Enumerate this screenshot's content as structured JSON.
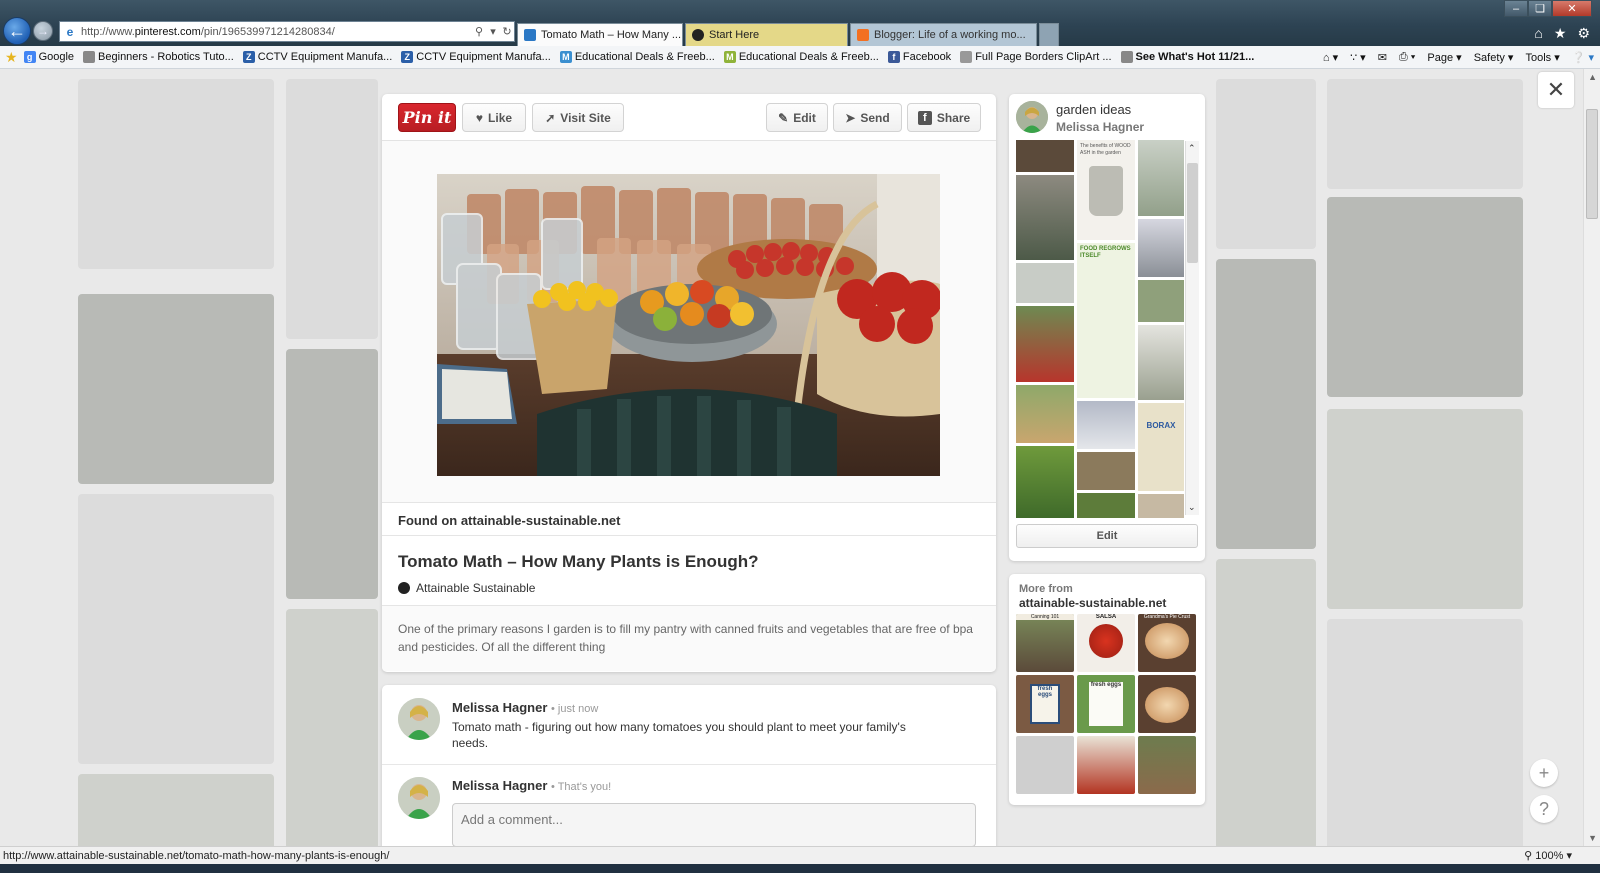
{
  "browser": {
    "address": {
      "prefix": "http://www.",
      "domain": "pinterest.com",
      "path": "/pin/196539971214280834/"
    },
    "tabs": [
      {
        "label": "Tomato Math – How Many ...",
        "active": true,
        "icon_color": "#2b78c5"
      },
      {
        "label": "Start Here",
        "active": false,
        "icon_color": "#222222"
      },
      {
        "label": "Blogger: Life of a working mo...",
        "active": false,
        "icon_color": "#f37021"
      }
    ],
    "favorites": [
      {
        "label": "Google",
        "icon_color": "#4285f4",
        "glyph": "g"
      },
      {
        "label": "Beginners - Robotics Tuto...",
        "icon_color": "#888888",
        "glyph": ""
      },
      {
        "label": "CCTV Equipment Manufa...",
        "icon_color": "#2b5fa8",
        "glyph": "Z"
      },
      {
        "label": "CCTV Equipment Manufa...",
        "icon_color": "#2b5fa8",
        "glyph": "Z"
      },
      {
        "label": "Educational Deals & Freeb...",
        "icon_color": "#3a8fd0",
        "glyph": "M"
      },
      {
        "label": "Educational Deals & Freeb...",
        "icon_color": "#8fb33a",
        "glyph": "M"
      },
      {
        "label": "Facebook",
        "icon_color": "#3b5998",
        "glyph": "f"
      },
      {
        "label": "Full Page Borders ClipArt ...",
        "icon_color": "#999999",
        "glyph": ""
      },
      {
        "label": "See What's Hot 11/21...",
        "icon_color": "#888888",
        "glyph": ""
      }
    ],
    "command_bar": {
      "page": "Page",
      "safety": "Safety",
      "tools": "Tools"
    },
    "status_url": "http://www.attainable-sustainable.net/tomato-math-how-many-plants-is-enough/",
    "zoom": "100%"
  },
  "pin": {
    "buttons": {
      "pinit": "Pin it",
      "like": "Like",
      "visit": "Visit Site",
      "edit": "Edit",
      "send": "Send",
      "share": "Share"
    },
    "found_on_label": "Found on",
    "found_on_domain": "attainable-sustainable.net",
    "title": "Tomato Math – How Many Plants is Enough?",
    "source": "Attainable Sustainable",
    "description": "One of the primary reasons I garden is to fill my pantry with canned fruits and vegetables that are free of bpa and pesticides. Of all the different thing"
  },
  "comments": [
    {
      "name": "Melissa Hagner",
      "time": "• just now",
      "text": "Tomato math - figuring out how many tomatoes you should plant to meet your family's needs."
    },
    {
      "name": "Melissa Hagner",
      "time": "• That's you!",
      "text": ""
    }
  ],
  "comment_input": {
    "placeholder": "Add a comment..."
  },
  "board": {
    "name": "garden ideas",
    "owner": "Melissa Hagner",
    "edit_label": "Edit",
    "thumb_texts": {
      "wood_ash": "The benefits of WOOD ASH in the garden",
      "food": "FOOD REGROWS ITSELF",
      "borax": "BORAX"
    }
  },
  "more_from": {
    "label": "More from",
    "domain": "attainable-sustainable.net",
    "thumb_texts": {
      "salsa": "SALSA",
      "pie_crust": "Grandma's Pie Crust",
      "eggs": "fresh eggs",
      "canning": "Canning 101"
    }
  },
  "colors": {
    "pin_red": "#cb2027",
    "overlay_bg": "#e9e9e9",
    "chrome_dark": "#2d4353"
  }
}
